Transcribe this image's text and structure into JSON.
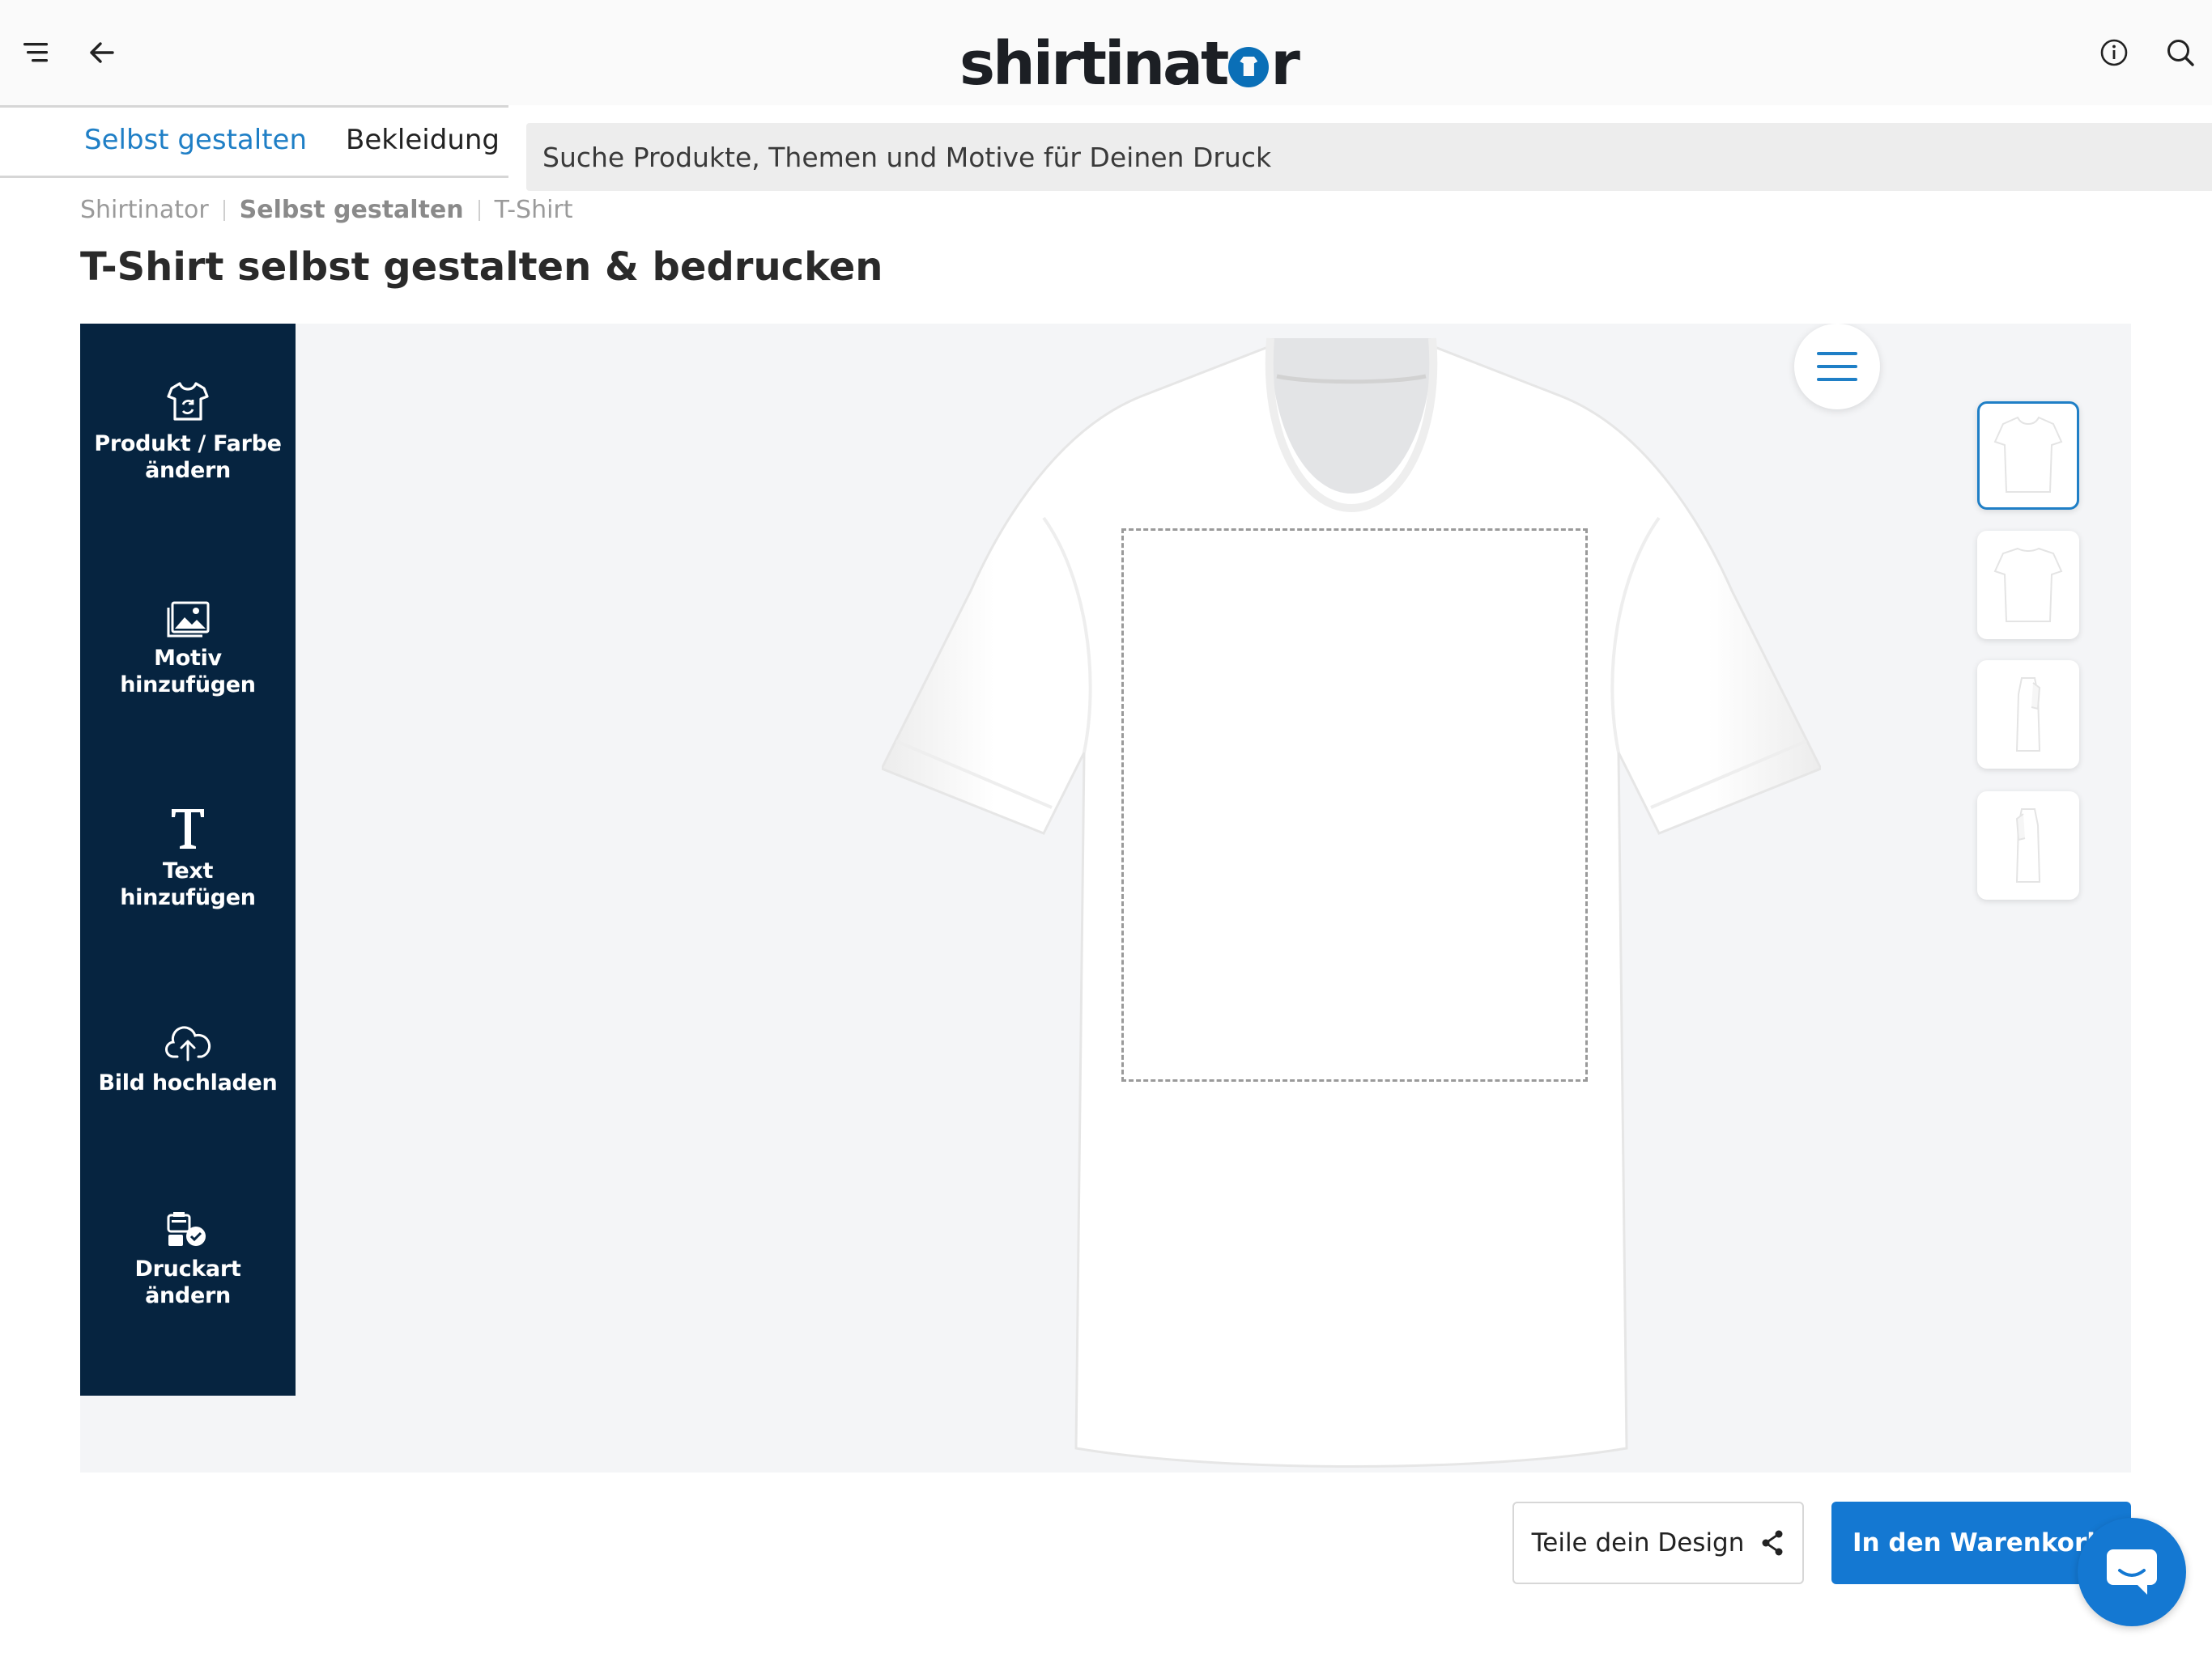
{
  "header": {
    "menu_icon": "hamburger-menu-icon",
    "back_icon": "arrow-left-icon",
    "logo_text": {
      "before": "shirtinat",
      "after": "r"
    },
    "info_icon": "info-icon",
    "search_icon": "search-icon"
  },
  "tabs": [
    {
      "label": "Selbst gestalten",
      "active": true
    },
    {
      "label": "Bekleidung",
      "active": false
    }
  ],
  "search": {
    "placeholder": "Suche Produkte, Themen und Motive für Deinen Druck",
    "value": ""
  },
  "breadcrumb": [
    "Shirtinator",
    "Selbst gestalten",
    "T-Shirt"
  ],
  "page_title": "T-Shirt selbst gestalten & bedrucken",
  "toolbar": [
    {
      "label_line1": "Produkt / Farbe",
      "label_line2": "ändern",
      "icon": "tshirt-swap-icon"
    },
    {
      "label_line1": "Motiv",
      "label_line2": "hinzufügen",
      "icon": "image-gallery-icon"
    },
    {
      "label_line1": "Text",
      "label_line2": "hinzufügen",
      "icon": "text-t-icon"
    },
    {
      "label_line1": "Bild hochladen",
      "label_line2": "",
      "icon": "cloud-upload-icon"
    },
    {
      "label_line1": "Druckart",
      "label_line2": "ändern",
      "icon": "print-method-icon"
    }
  ],
  "views": [
    "front",
    "back",
    "left-sleeve",
    "right-sleeve"
  ],
  "selected_view": 0,
  "actions": {
    "share_label": "Teile dein Design",
    "cart_label": "In den Warenkorb"
  },
  "colors": {
    "accent": "#1f7fc6",
    "toolbar_bg": "#062440",
    "cart_bg": "#1478d2",
    "shirt": "#ffffff"
  }
}
